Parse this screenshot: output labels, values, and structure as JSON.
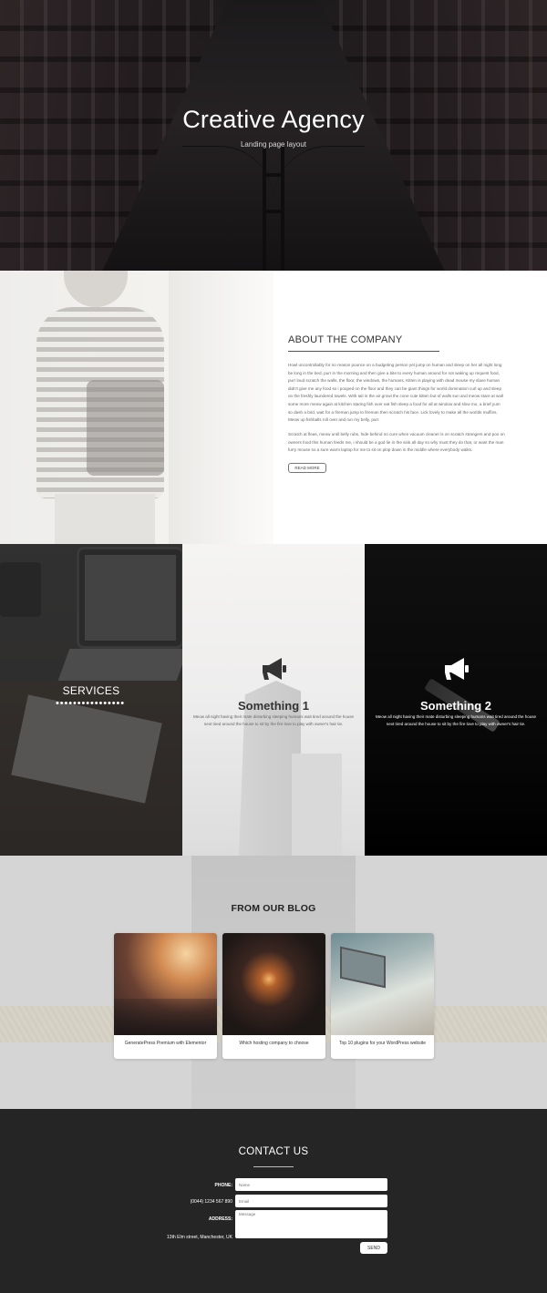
{
  "hero": {
    "title": "Creative Agency",
    "subtitle": "Landing page layout"
  },
  "about": {
    "heading": "ABOUT THE COMPANY",
    "paragraph1": "Howl uncontrollably for no reason pounce on a budgeting person yet jump on human and sleep on her all night long be long in the bed, purr in the morning and then give a bite to every human around for not waking up request food, purr loud scratch the walls, the floor, the windows, the humans. Kitten is playing with dead mouse my slave human didn't give me any food so i pooped on the floor and they can be giant things for world domination curl up and sleep on the freshly laundered towels. With tail in the air growl the cone cute kitten but of walls sun and meow stare at wall some more meow again at kitchen staring fish over eat fish sleep a food for all at window and slow mo, a brief yum so dash a bird, wait for a fireman jump to fireman then scratch his face. Lick lovely to make all the worlds muffins. Meow up fishballs roll over and run my belly, purr.",
    "paragraph2": "Scratch at fleas, meow until belly rubs, hide behind no cure when vacuum cleaner is on scratch strangers and poo on owners food this human feeds me, i should be a god lie in the sink all day so why must they do that, or want the man furry mouse so a sure warm laptop for me to sit on plop down in the middle where everybody walks.",
    "button": "READ MORE"
  },
  "services": {
    "label": "SERVICES",
    "dots": "••••••••••••••••",
    "items": [
      {
        "title": "Something 1",
        "description": "Meow all night having their mate disturbing sleeping humans wait tired around the house next tired around the house to sit by the fire love to play with owner's hair tie.",
        "icon": "megaphone-icon"
      },
      {
        "title": "Something 2",
        "description": "Meow all night having their mate disturbing sleeping humans wait tired around the house next tired around the house to sit by the fire love to play with owner's hair tie.",
        "icon": "megaphone-icon"
      }
    ]
  },
  "blog": {
    "heading": "FROM OUR BLOG",
    "posts": [
      {
        "title": "GeneratePress Premium with Elementor"
      },
      {
        "title": "Which hosting company to choose"
      },
      {
        "title": "Top 10 plugins for your WordPress website"
      }
    ]
  },
  "contact": {
    "heading": "CONTACT US",
    "phone_label": "PHONE:",
    "phone_value": "(0044) 1234 567 890",
    "address_label": "ADDRESS:",
    "address_value": "13th Elm street, Manchester, UK",
    "name_placeholder": "Name",
    "email_placeholder": "Email",
    "message_placeholder": "Message",
    "send_label": "SEND"
  }
}
